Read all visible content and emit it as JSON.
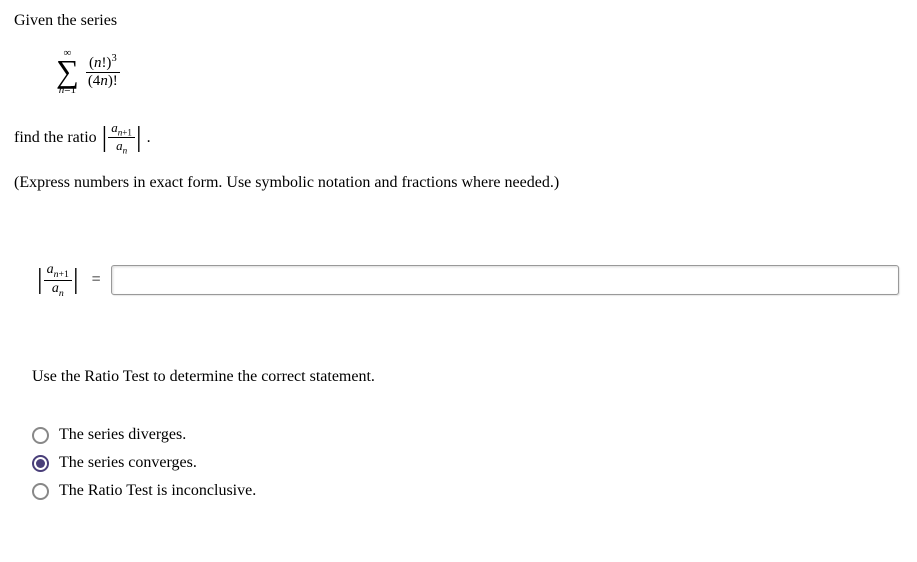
{
  "intro": "Given the series",
  "series": {
    "sigma_top": "∞",
    "sigma_bottom_var": "n",
    "sigma_bottom_eq": "=1",
    "numerator_left": "(",
    "numerator_var": "n",
    "numerator_right": "!)",
    "numerator_exp": "3",
    "denominator_left": "(4",
    "denominator_var": "n",
    "denominator_right": ")!"
  },
  "find_ratio_prefix": "find the ratio ",
  "ratio": {
    "num_var": "a",
    "num_sub_var": "n",
    "num_sub_plus": "+1",
    "den_var": "a",
    "den_sub": "n"
  },
  "find_ratio_suffix": ".",
  "instruction": "(Express numbers in exact form. Use symbolic notation and fractions where needed.)",
  "equals": "=",
  "answer_value": "",
  "second_prompt": "Use the Ratio Test to determine the correct statement.",
  "options": [
    {
      "label": "The series diverges.",
      "selected": false
    },
    {
      "label": "The series converges.",
      "selected": true
    },
    {
      "label": "The Ratio Test is inconclusive.",
      "selected": false
    }
  ]
}
